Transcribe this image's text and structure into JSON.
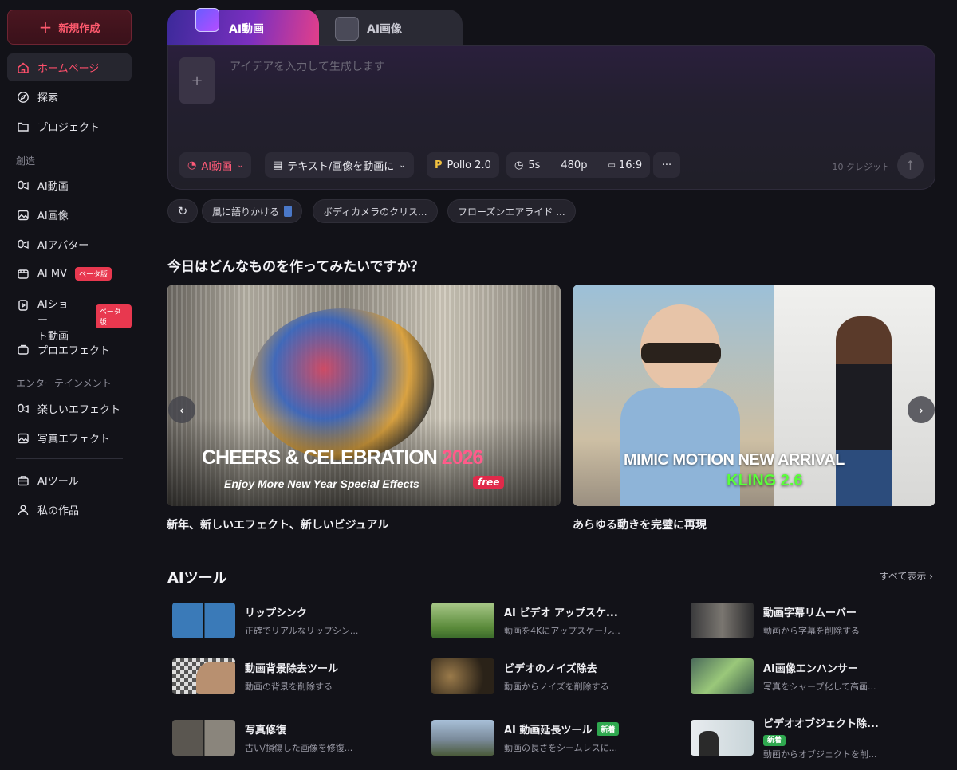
{
  "sidebar": {
    "new_button": "新規作成",
    "items": [
      {
        "label": "ホームページ"
      },
      {
        "label": "探索"
      },
      {
        "label": "プロジェクト"
      }
    ],
    "section_create": "創造",
    "create_items": [
      {
        "label": "AI動画"
      },
      {
        "label": "AI画像"
      },
      {
        "label": "AIアバター"
      },
      {
        "label": "AI MV",
        "badge": "ベータ版"
      },
      {
        "label_line1": "AIショー",
        "label_line2": "ト動画",
        "badge": "ベータ版"
      },
      {
        "label": "プロエフェクト"
      }
    ],
    "section_entertainment": "エンターテインメント",
    "ent_items": [
      {
        "label": "楽しいエフェクト"
      },
      {
        "label": "写真エフェクト"
      }
    ],
    "bottom_items": [
      {
        "label": "AIツール"
      },
      {
        "label": "私の作品"
      }
    ]
  },
  "tabs": {
    "video": "AI動画",
    "image": "AI画像"
  },
  "prompt": {
    "placeholder": "アイデアを入力して生成します",
    "upload_icon": "+",
    "chips": {
      "mode": "AI動画",
      "type": "テキスト/画像を動画に",
      "model": "Pollo 2.0",
      "duration": "5s",
      "resolution": "480p",
      "ratio": "16:9",
      "more": "···"
    },
    "credits": "10 クレジット"
  },
  "suggestions": [
    "風に語りかける",
    "ボディカメラのクリス...",
    "フローズンエアライド ..."
  ],
  "featured": {
    "heading": "今日はどんなものを作ってみたいですか？",
    "banners": [
      {
        "title": "CHEERS & CELEBRATION",
        "year": "2026",
        "subtitle": "Enjoy More New Year Special Effects",
        "tag": "free",
        "caption": "新年、新しいエフェクト、新しいビジュアル"
      },
      {
        "title": "MIMIC MOTION NEW ARRIVAL",
        "subtitle": "KLING 2.6",
        "caption": "あらゆる動きを完璧に再現"
      }
    ]
  },
  "tools": {
    "heading": "AIツール",
    "see_all": "すべて表示",
    "items": [
      {
        "title": "リップシンク",
        "desc": "正確でリアルなリップシン..."
      },
      {
        "title": "AI ビデオ アップスケ...",
        "desc": "動画を4Kにアップスケール..."
      },
      {
        "title": "動画字幕リムーバー",
        "desc": "動画から字幕を削除する"
      },
      {
        "title": "動画背景除去ツール",
        "desc": "動画の背景を削除する"
      },
      {
        "title": "ビデオのノイズ除去",
        "desc": "動画からノイズを削除する"
      },
      {
        "title": "AI画像エンハンサー",
        "desc": "写真をシャープ化して高画..."
      },
      {
        "title": "写真修復",
        "desc": "古い/損傷した画像を修復..."
      },
      {
        "title": "AI 動画延長ツール",
        "badge": "新着",
        "desc": "動画の長さをシームレスに..."
      },
      {
        "title": "ビデオオブジェクト除...",
        "badge": "新着",
        "desc": "動画からオブジェクトを削..."
      }
    ]
  },
  "colors": {
    "accent": "#ff4f6b",
    "background": "#121218"
  }
}
